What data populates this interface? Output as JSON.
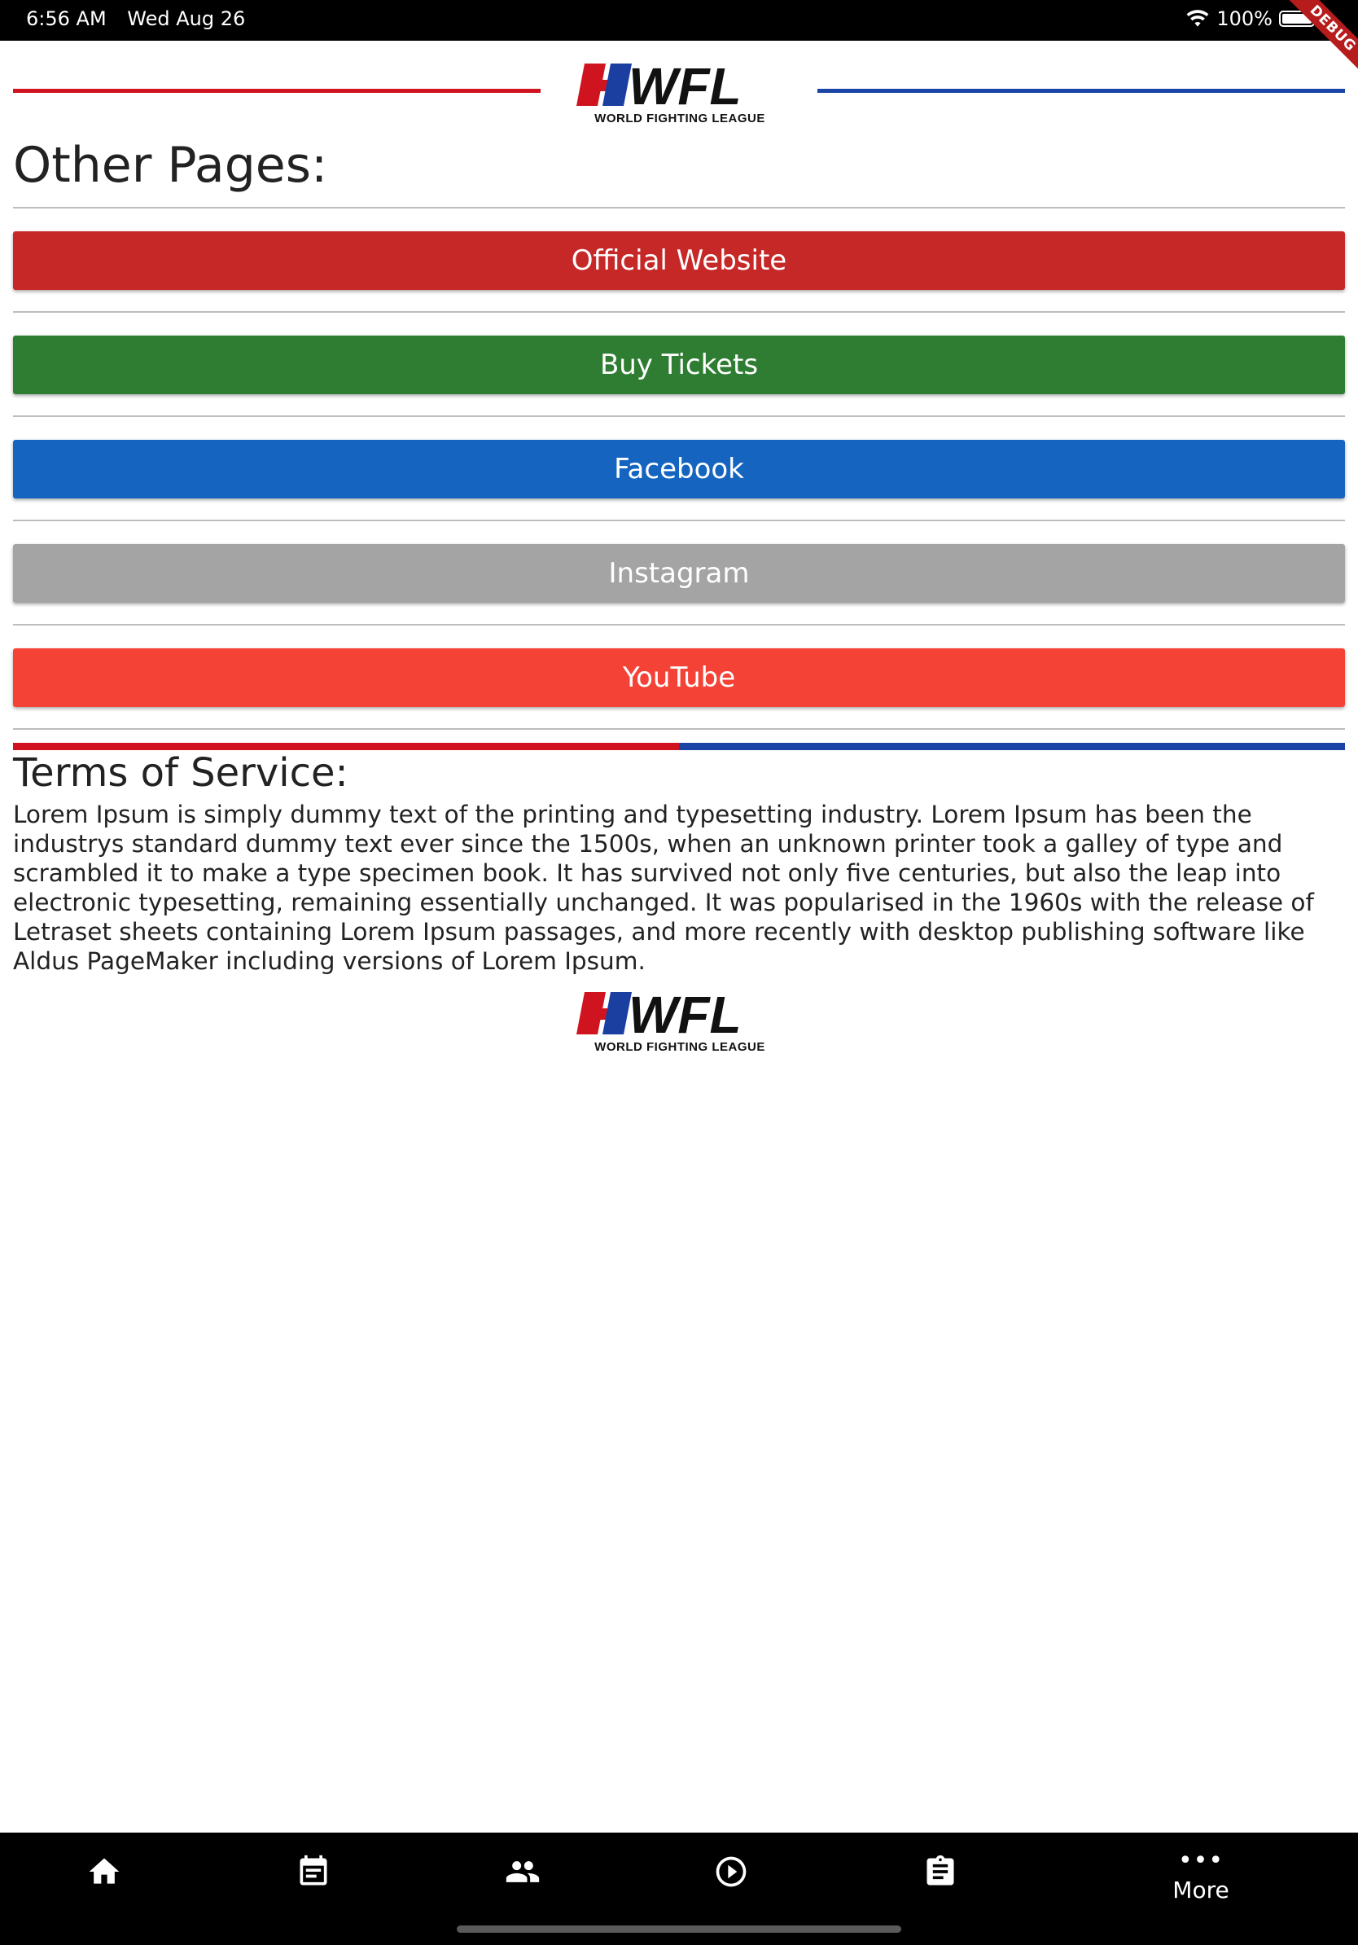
{
  "status_bar": {
    "time": "6:56 AM",
    "date": "Wed Aug 26",
    "battery": "100%",
    "debug_label": "DEBUG"
  },
  "header": {
    "logo_text": "WFL",
    "logo_subtitle": "WORLD FIGHTING LEAGUE"
  },
  "other_pages": {
    "title": "Other Pages:",
    "buttons": [
      {
        "label": "Official Website",
        "color": "#c62828"
      },
      {
        "label": "Buy Tickets",
        "color": "#2e7d32"
      },
      {
        "label": "Facebook",
        "color": "#1565c0"
      },
      {
        "label": "Instagram",
        "color": "#a4a4a4"
      },
      {
        "label": "YouTube",
        "color": "#f44336"
      }
    ]
  },
  "terms": {
    "title": "Terms of Service:",
    "body": "Lorem Ipsum is simply dummy text of the printing and typesetting industry. Lorem Ipsum has been the industrys standard dummy text ever since the 1500s, when an unknown printer took a galley of type and scrambled it to make a type specimen book. It has survived not only five centuries, but also the leap into electronic typesetting, remaining essentially unchanged. It was popularised in the 1960s with the release of Letraset sheets containing Lorem Ipsum passages, and more recently with desktop publishing software like Aldus PageMaker including versions of Lorem Ipsum."
  },
  "footer": {
    "logo_text": "WFL",
    "logo_subtitle": "WORLD FIGHTING LEAGUE"
  },
  "bottom_nav": {
    "items": [
      {
        "icon": "home-icon"
      },
      {
        "icon": "calendar-icon"
      },
      {
        "icon": "people-icon"
      },
      {
        "icon": "play-circle-icon"
      },
      {
        "icon": "clipboard-icon"
      },
      {
        "icon": "more-dots-icon",
        "label": "More"
      }
    ]
  },
  "colors": {
    "brand_red": "#d0141f",
    "brand_blue": "#1a44a5"
  }
}
